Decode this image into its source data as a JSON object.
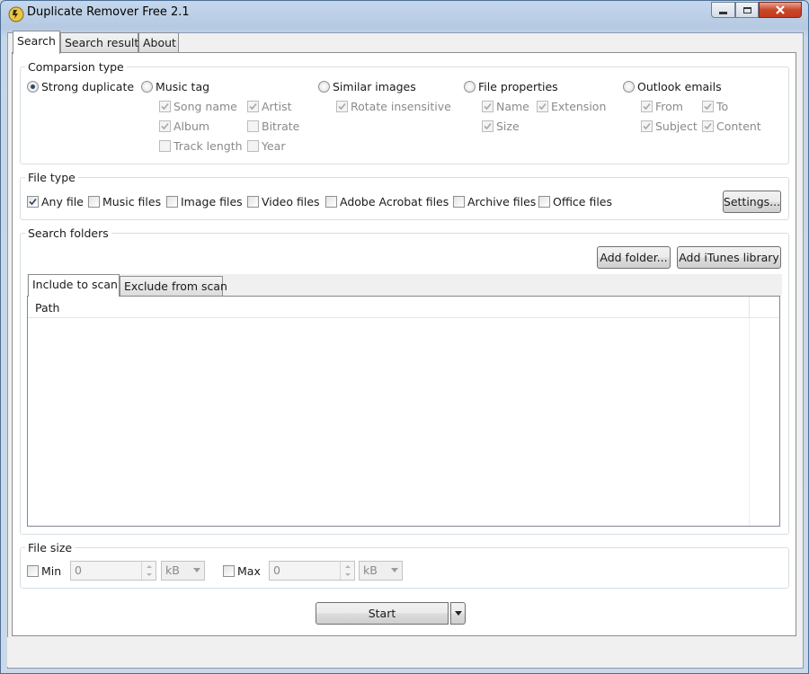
{
  "window": {
    "title": "Duplicate Remover Free 2.1",
    "controls": {
      "minimize": "minimize-icon",
      "maximize": "maximize-icon",
      "close": "close-icon"
    }
  },
  "tabs": [
    "Search",
    "Search result",
    "About"
  ],
  "comparison": {
    "legend": "Comparsion type",
    "options": [
      "Strong duplicate",
      "Music tag",
      "Similar images",
      "File properties",
      "Outlook emails"
    ],
    "selected": "Strong duplicate",
    "music_tag": {
      "song_name": "Song name",
      "artist": "Artist",
      "album": "Album",
      "bitrate": "Bitrate",
      "track_length": "Track length",
      "year": "Year"
    },
    "similar_images": {
      "rotate_insensitive": "Rotate insensitive"
    },
    "file_properties": {
      "name": "Name",
      "extension": "Extension",
      "size": "Size"
    },
    "outlook": {
      "from": "From",
      "to": "To",
      "subject": "Subject",
      "content": "Content"
    }
  },
  "file_type": {
    "legend": "File type",
    "options": [
      "Any file",
      "Music files",
      "Image files",
      "Video files",
      "Adobe Acrobat files",
      "Archive files",
      "Office files"
    ],
    "checked": "Any file",
    "settings_button": "Settings..."
  },
  "search_folders": {
    "legend": "Search folders",
    "add_folder_button": "Add folder...",
    "add_itunes_button": "Add iTunes library",
    "tabs": [
      "Include to scan",
      "Exclude from scan"
    ],
    "list_header": "Path",
    "rows": []
  },
  "file_size": {
    "legend": "File size",
    "min_label": "Min",
    "min_value": "0",
    "min_unit": "kB",
    "max_label": "Max",
    "max_value": "0",
    "max_unit": "kB"
  },
  "start_button": "Start",
  "colors": {
    "accent": "#2a4a6a",
    "frame": "#c5d7ec",
    "close": "#c53a1c"
  }
}
